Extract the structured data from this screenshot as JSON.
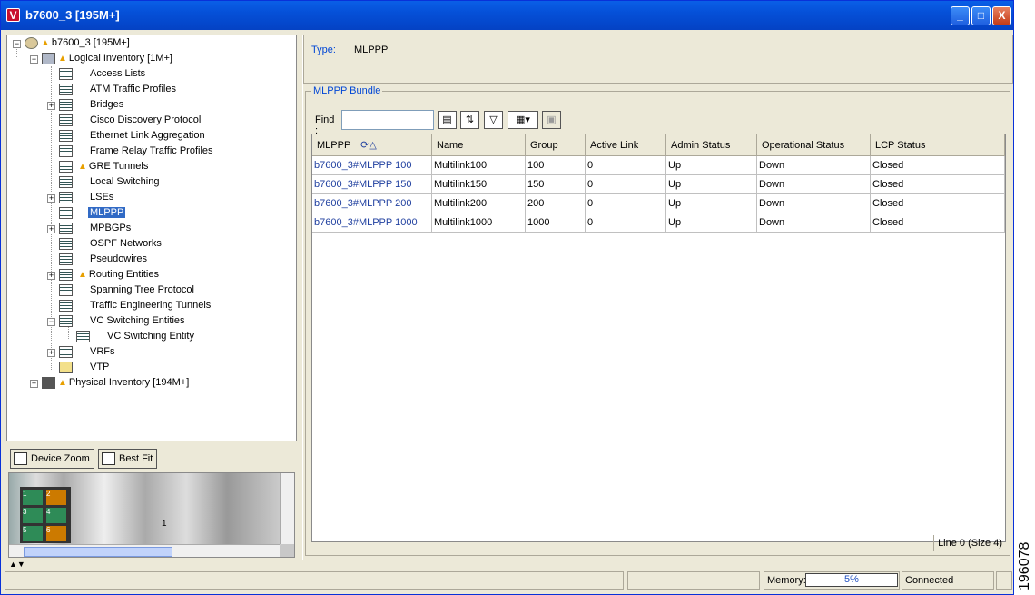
{
  "window": {
    "title": "b7600_3 [195M+]",
    "app_icon_letter": "V",
    "controls": {
      "minimize": "_",
      "maximize": "□",
      "close": "X"
    }
  },
  "tree": {
    "root": "b7600_3 [195M+]",
    "logical": "Logical Inventory [1M+]",
    "items": [
      "Access Lists",
      "ATM Traffic Profiles",
      "Bridges",
      "Cisco Discovery Protocol",
      "Ethernet Link Aggregation",
      "Frame Relay Traffic Profiles",
      "GRE Tunnels",
      "Local Switching",
      "LSEs",
      "MLPPP",
      "MPBGPs",
      "OSPF Networks",
      "Pseudowires",
      "Routing Entities",
      "Spanning Tree Protocol",
      "Traffic Engineering Tunnels",
      "VC Switching Entities",
      "VC Switching Entity",
      "VRFs",
      "VTP"
    ],
    "physical": "Physical Inventory [194M+]",
    "selected": "MLPPP"
  },
  "zoom": {
    "device_zoom": "Device Zoom",
    "best_fit": "Best Fit"
  },
  "overview": {
    "slot_label": "1",
    "port_labels": [
      "1",
      "2",
      "3",
      "4",
      "5",
      "6"
    ]
  },
  "details": {
    "type_label": "Type:",
    "type_value": "MLPPP"
  },
  "group": {
    "title": "MLPPP Bundle"
  },
  "find": {
    "label": "Find :",
    "value": ""
  },
  "table": {
    "columns": [
      "MLPPP",
      "Name",
      "Group",
      "Active Link",
      "Admin Status",
      "Operational Status",
      "LCP Status"
    ],
    "rows": [
      [
        "b7600_3#MLPPP 100",
        "Multilink100",
        "100",
        "0",
        "Up",
        "Down",
        "Closed"
      ],
      [
        "b7600_3#MLPPP 150",
        "Multilink150",
        "150",
        "0",
        "Up",
        "Down",
        "Closed"
      ],
      [
        "b7600_3#MLPPP 200",
        "Multilink200",
        "200",
        "0",
        "Up",
        "Down",
        "Closed"
      ],
      [
        "b7600_3#MLPPP 1000",
        "Multilink1000",
        "1000",
        "0",
        "Up",
        "Down",
        "Closed"
      ]
    ],
    "line_info": "Line 0 (Size 4)"
  },
  "status": {
    "memory_label": "Memory:",
    "memory_value": "5%",
    "connection": "Connected"
  },
  "figure_id": "196078"
}
